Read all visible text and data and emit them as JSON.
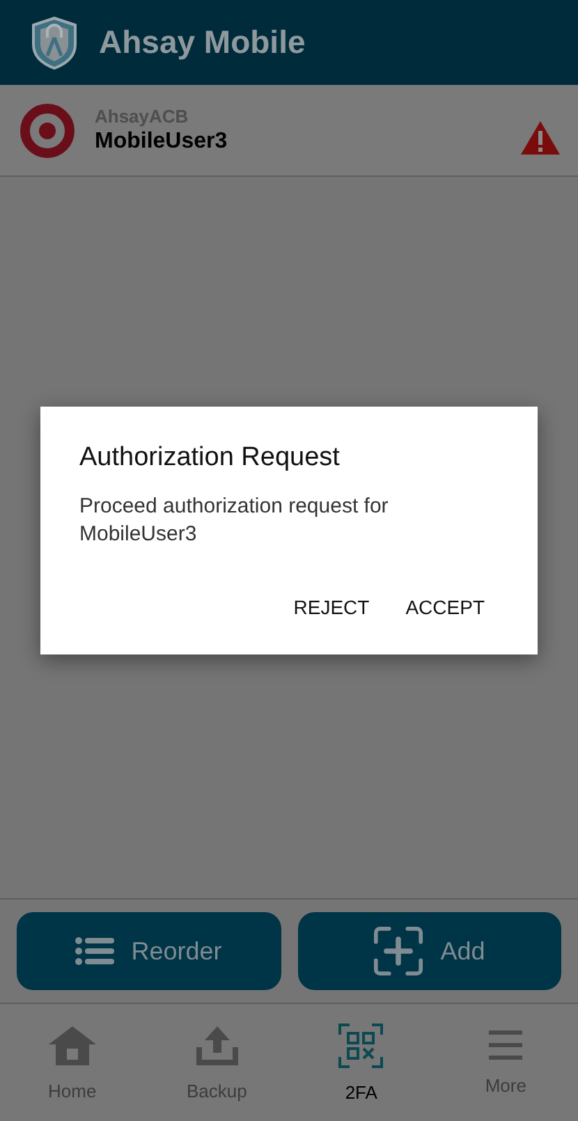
{
  "app_bar": {
    "title": "Ahsay Mobile"
  },
  "account": {
    "server": "AhsayACB",
    "user": "MobileUser3",
    "warning": true
  },
  "dialog": {
    "title": "Authorization Request",
    "message": "Proceed authorization request for MobileUser3",
    "buttons": [
      "REJECT",
      "ACCEPT"
    ]
  },
  "actions": [
    {
      "kind": "reorder",
      "label": "Reorder"
    },
    {
      "kind": "add",
      "label": "Add"
    }
  ],
  "nav": [
    {
      "kind": "home",
      "label": "Home",
      "selected": false
    },
    {
      "kind": "backup",
      "label": "Backup",
      "selected": false
    },
    {
      "kind": "qr",
      "label": "2FA",
      "selected": true
    },
    {
      "kind": "more",
      "label": "More",
      "selected": false
    }
  ]
}
